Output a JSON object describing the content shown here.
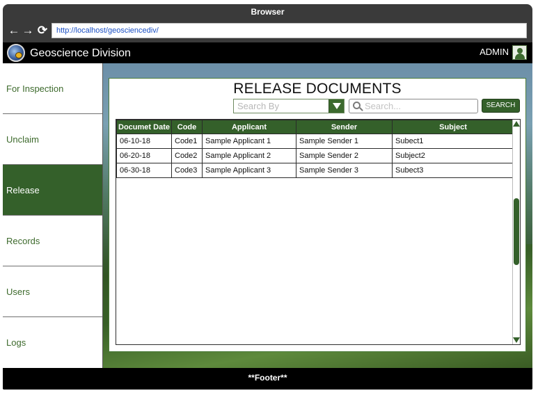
{
  "browser": {
    "title": "Browser",
    "url": "http://localhost/geosciencediv/",
    "back_icon": "←",
    "forward_icon": "→",
    "refresh_icon": "⟳"
  },
  "header": {
    "title": "Geoscience Division",
    "user": "ADMIN",
    "background": "#000000"
  },
  "sidebar": {
    "items": [
      {
        "label": "For Inspection",
        "active": false
      },
      {
        "label": "Unclaim",
        "active": false
      },
      {
        "label": "Release",
        "active": true
      },
      {
        "label": "Records",
        "active": false
      },
      {
        "label": "Users",
        "active": false
      },
      {
        "label": "Logs",
        "active": false
      }
    ],
    "accent_color": "#34602a"
  },
  "main": {
    "title": "RELEASE DOCUMENTS",
    "search_by_placeholder": "Search By",
    "search_placeholder": "Search...",
    "search_button": "SEARCH",
    "table": {
      "columns": [
        "Documet Date",
        "Code",
        "Applicant",
        "Sender",
        "Subject"
      ],
      "rows": [
        [
          "06-10-18",
          "Code1",
          "Sample Applicant 1",
          "Sample Sender 1",
          "Subect1"
        ],
        [
          "06-20-18",
          "Code2",
          "Sample Applicant 2",
          "Sample Sender 2",
          "Subject2"
        ],
        [
          "06-30-18",
          "Code3",
          "Sample Applicant 3",
          "Sample Sender 3",
          "Subect3"
        ]
      ]
    }
  },
  "footer": {
    "text": "**Footer**"
  }
}
